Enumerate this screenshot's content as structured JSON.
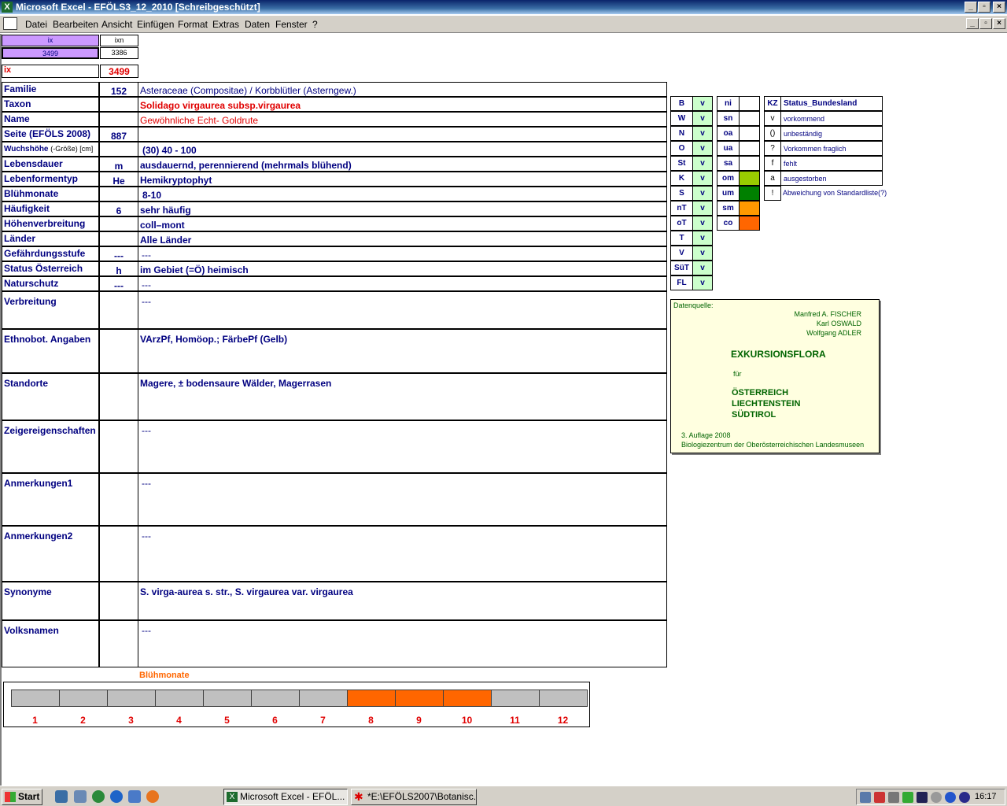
{
  "window": {
    "title": "Microsoft Excel - EFÖLS3_12_2010  [Schreibgeschützt]"
  },
  "menu": [
    "Datei",
    "Bearbeiten",
    "Ansicht",
    "Einfügen",
    "Format",
    "Extras",
    "Daten",
    "Fenster",
    "?"
  ],
  "top": {
    "ix_label": "ix",
    "ixn_label": "ixn",
    "ix_value": "3499",
    "ixn_value": "3386",
    "ix_row_label": "ix",
    "ix_row_value": "3499"
  },
  "rows": [
    {
      "label": "Familie",
      "code": "152",
      "text": "Asteraceae (Compositae)  /  Korbblütler (Asterngew.)"
    },
    {
      "label": "Taxon",
      "code": "",
      "text": "Solidago virgaurea subsp.virgaurea"
    },
    {
      "label": "Name",
      "code": "",
      "text": "Gewöhnliche Echt- Goldrute"
    },
    {
      "label": "Seite (EFÖLS 2008)",
      "code": "887",
      "text": ""
    },
    {
      "label": "Wuchshöhe",
      "label_suffix": "(-Größe) [cm]",
      "code": "",
      "text": "(30) 40 - 100"
    },
    {
      "label": "Lebensdauer",
      "code": "m",
      "text": "ausdauernd, perennierend (mehrmals blühend)"
    },
    {
      "label": "Lebenformentyp",
      "code": "He",
      "text": "Hemikryptophyt"
    },
    {
      "label": "Blühmonate",
      "code": "",
      "text": "8-10"
    },
    {
      "label": "Häufigkeit",
      "code": "6",
      "text": "sehr häufig"
    },
    {
      "label": "Höhenverbreitung",
      "code": "",
      "text": "coll–mont"
    },
    {
      "label": "Länder",
      "code": "",
      "text": "Alle Länder"
    },
    {
      "label": "Gefährdungsstufe",
      "code": "---",
      "text": "---"
    },
    {
      "label": "Status Österreich",
      "code": "h",
      "text": "im Gebiet (=Ö) heimisch"
    },
    {
      "label": "Naturschutz",
      "code": "---",
      "text": "---"
    },
    {
      "label": "Verbreitung",
      "code": "",
      "text": "---"
    },
    {
      "label": "Ethnobot. Angaben",
      "code": "",
      "text": "VArzPf, Homöop.; FärbePf (Gelb)"
    },
    {
      "label": "Standorte",
      "code": "",
      "text": "Magere, ± bodensaure Wälder, Magerrasen"
    },
    {
      "label": "Zeigereigenschaften",
      "code": "",
      "text": "---"
    },
    {
      "label": "Anmerkungen1",
      "code": "",
      "text": "---"
    },
    {
      "label": "Anmerkungen2",
      "code": "",
      "text": "---"
    },
    {
      "label": "Synonyme",
      "code": "",
      "text": "S. virga-aurea s. str., S. virgaurea var. virgaurea"
    },
    {
      "label": "Volksnamen",
      "code": "",
      "text": "---"
    }
  ],
  "regions": [
    {
      "code": "B",
      "v": "v"
    },
    {
      "code": "W",
      "v": "v"
    },
    {
      "code": "N",
      "v": "v"
    },
    {
      "code": "O",
      "v": "v"
    },
    {
      "code": "St",
      "v": "v"
    },
    {
      "code": "K",
      "v": "v"
    },
    {
      "code": "S",
      "v": "v"
    },
    {
      "code": "nT",
      "v": "v"
    },
    {
      "code": "oT",
      "v": "v"
    },
    {
      "code": "T",
      "v": "v"
    },
    {
      "code": "V",
      "v": "v"
    },
    {
      "code": "SüT",
      "v": "v"
    },
    {
      "code": "FL",
      "v": "v"
    }
  ],
  "altitude": [
    {
      "code": "ni",
      "color": ""
    },
    {
      "code": "sn",
      "color": ""
    },
    {
      "code": "oa",
      "color": ""
    },
    {
      "code": "ua",
      "color": ""
    },
    {
      "code": "sa",
      "color": ""
    },
    {
      "code": "om",
      "color": "#99cc00"
    },
    {
      "code": "um",
      "color": "#008000"
    },
    {
      "code": "sm",
      "color": "#ff9900"
    },
    {
      "code": "co",
      "color": "#ff6600"
    }
  ],
  "legend": {
    "header_code": "KZ",
    "header_text": "Status_Bundesland",
    "items": [
      {
        "code": "v",
        "text": "vorkommend"
      },
      {
        "code": "()",
        "text": "unbeständig"
      },
      {
        "code": "?",
        "text": "Vorkommen fraglich"
      },
      {
        "code": "f",
        "text": "fehlt"
      },
      {
        "code": "a",
        "text": "ausgestorben"
      },
      {
        "code": "!",
        "text": "Abweichung von Standardliste(?)"
      }
    ]
  },
  "source": {
    "label": "Datenquelle:",
    "authors": [
      "Manfred A. FISCHER",
      "Karl OSWALD",
      "Wolfgang ADLER"
    ],
    "title": "EXKURSIONSFLORA",
    "fuer": "für",
    "countries": [
      "ÖSTERREICH",
      "LIECHTENSTEIN",
      "SÜDTIROL"
    ],
    "edition": "3. Auflage 2008",
    "publisher": "Biologiezentrum der Oberösterreichischen Landesmuseen"
  },
  "months": {
    "title": "Blühmonate",
    "labels": [
      "1",
      "2",
      "3",
      "4",
      "5",
      "6",
      "7",
      "8",
      "9",
      "10",
      "11",
      "12"
    ],
    "active": [
      8,
      9,
      10
    ],
    "active_color": "#ff6600",
    "inactive_color": "#c0c0c0"
  },
  "taskbar": {
    "start": "Start",
    "tasks": [
      "Microsoft Excel - EFÖL...",
      "*E:\\EFÖLS2007\\Botanisc..."
    ],
    "clock": "16:17"
  }
}
